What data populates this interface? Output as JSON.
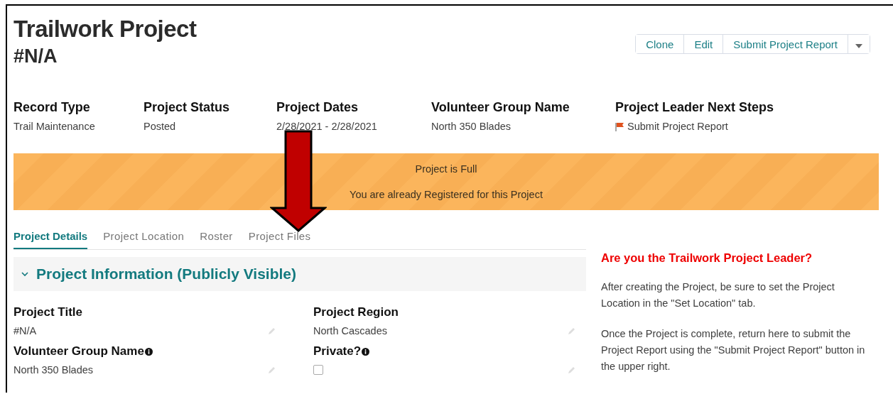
{
  "header": {
    "title": "Trailwork Project",
    "subtitle": "#N/A"
  },
  "actions": [
    {
      "label": "Clone"
    },
    {
      "label": "Edit"
    },
    {
      "label": "Submit Project Report"
    }
  ],
  "highlights": [
    {
      "label": "Record Type",
      "value": "Trail Maintenance"
    },
    {
      "label": "Project Status",
      "value": "Posted"
    },
    {
      "label": "Project Dates",
      "value": "2/28/2021 - 2/28/2021"
    },
    {
      "label": "Volunteer Group Name",
      "value": "North 350 Blades"
    },
    {
      "label": "Project Leader Next Steps",
      "value": "Submit Project Report",
      "kind": "flag"
    }
  ],
  "banner": {
    "lines": [
      "Project is Full",
      "You are already Registered for this Project"
    ]
  },
  "tabs": [
    {
      "label": "Project Details",
      "selected": true
    },
    {
      "label": "Project Location",
      "selected": false
    },
    {
      "label": "Roster",
      "selected": false
    },
    {
      "label": "Project Files",
      "selected": false
    }
  ],
  "section": {
    "title": "Project Information (Publicly Visible)",
    "expanded": true,
    "fields": [
      {
        "label": "Project Title",
        "value": "#N/A",
        "kind": "text",
        "info": false
      },
      {
        "label": "Project Region",
        "value": "North Cascades",
        "kind": "text",
        "info": false
      },
      {
        "label": "Volunteer Group Name",
        "value": "North 350 Blades",
        "kind": "text",
        "info": true
      },
      {
        "label": "Private?",
        "kind": "checkbox",
        "checked": false,
        "info": true
      }
    ]
  },
  "help": {
    "title": "Are you the Trailwork Project Leader?",
    "paragraphs": [
      "After creating the Project, be sure to set the Project Location in the \"Set Location\" tab.",
      "Once the Project is complete, return here to submit the Project Report using the \"Submit Project Report\" button in the upper right."
    ]
  }
}
